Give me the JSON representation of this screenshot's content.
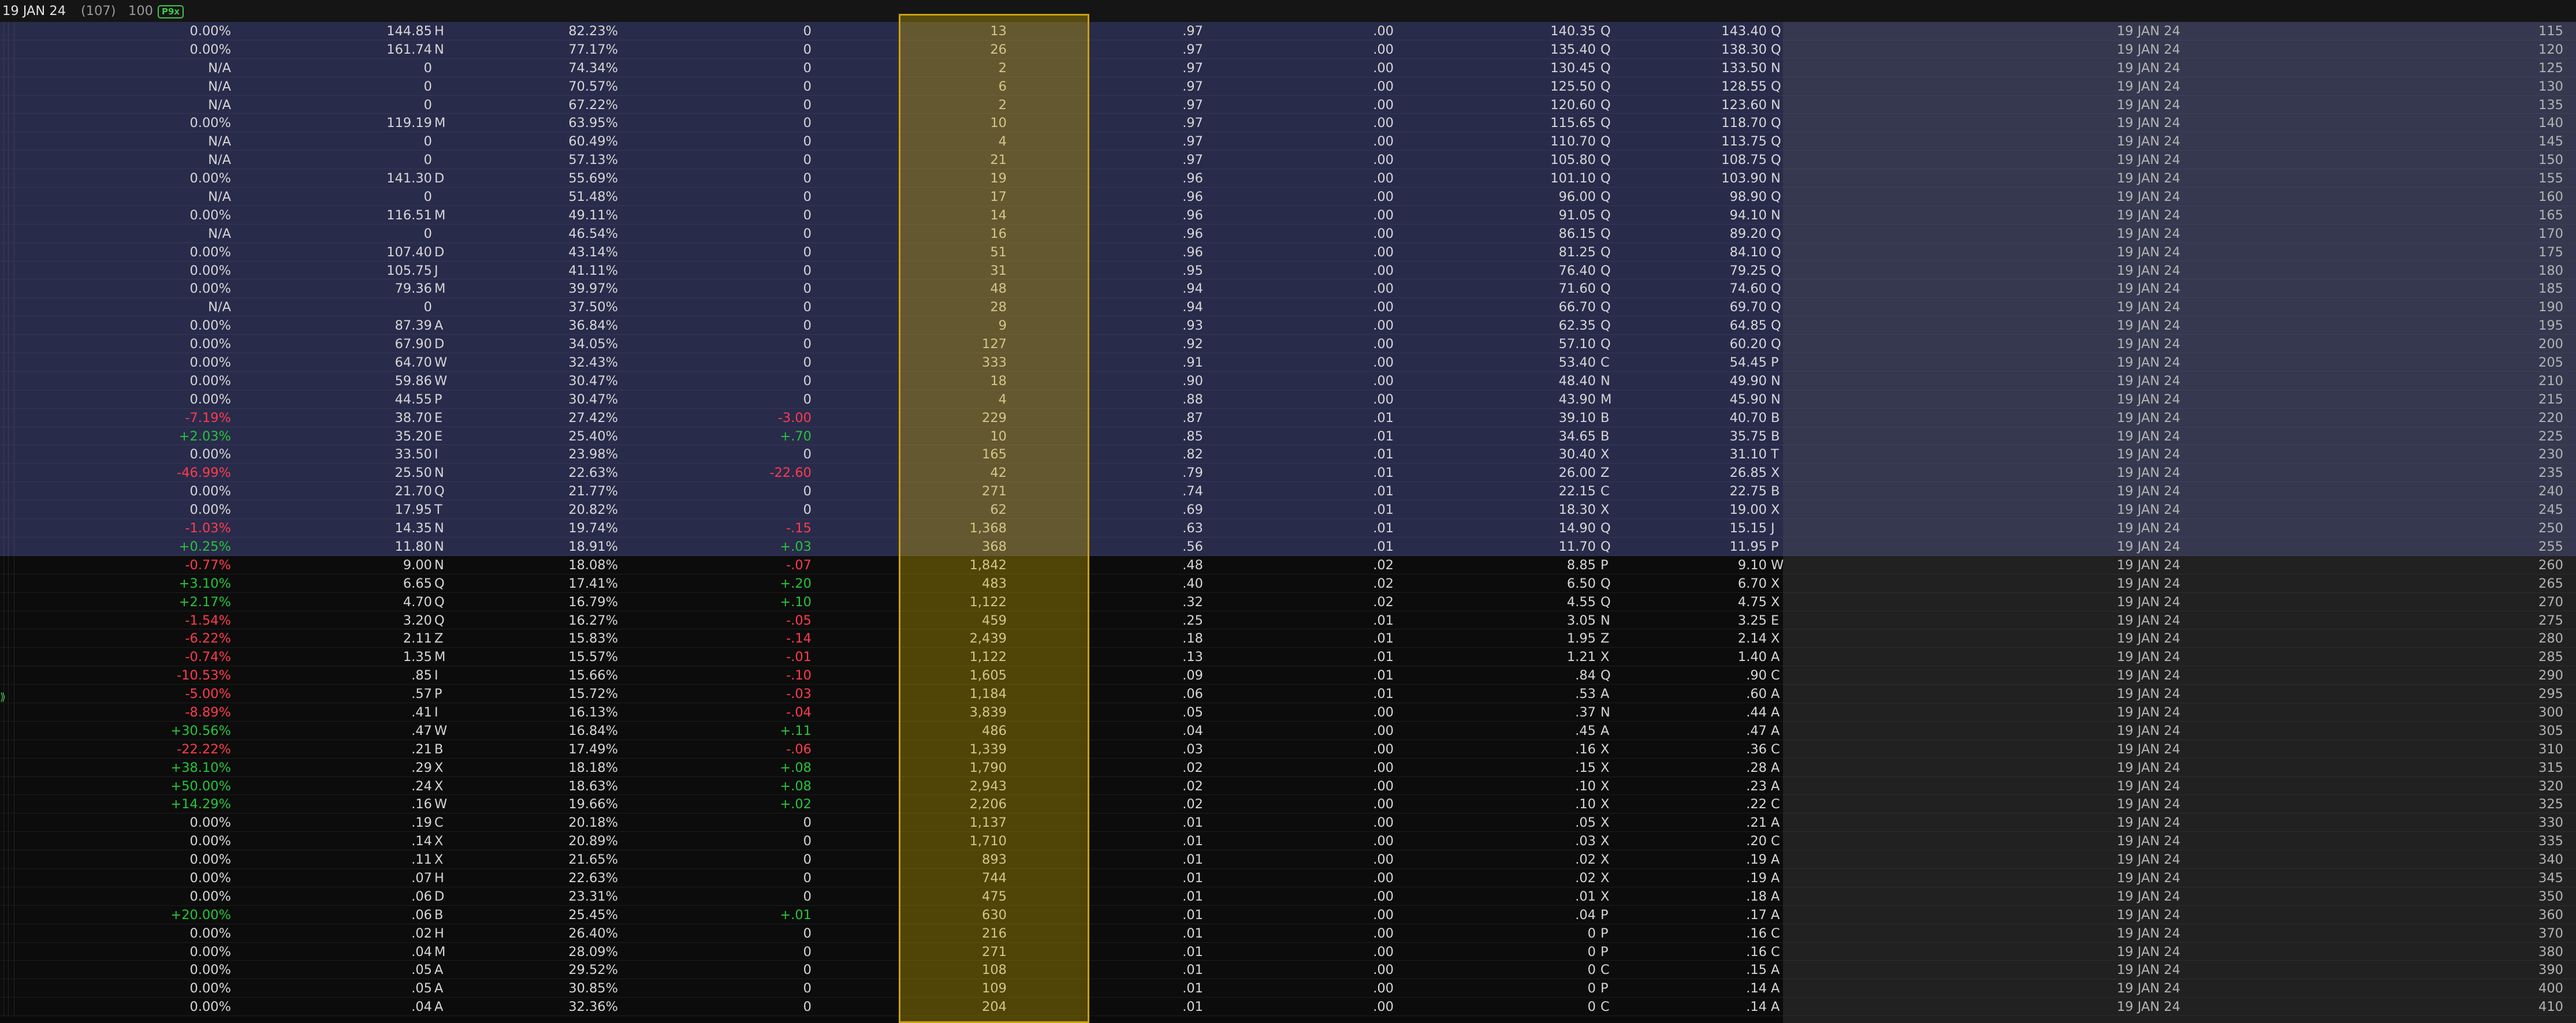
{
  "header": {
    "expiration_label": "19 JAN 24",
    "days_to_expiration": "(107)",
    "multiplier": "100",
    "badge": "P9x"
  },
  "colors": {
    "itm_background": "#292b4b",
    "otm_background": "#0c0c0c",
    "volume_highlight": "#ceaa00",
    "positive": "#26c53a",
    "negative": "#ff3b4d"
  },
  "rows": [
    {
      "chg": "0.00%",
      "last": "144.85",
      "last_x": "H",
      "iv": "82.23%",
      "net_chg": "0",
      "volume": "13",
      "delta": ".97",
      "gamma": ".00",
      "bid": "140.35",
      "bid_x": "Q",
      "ask": "143.40",
      "ask_x": "Q",
      "exp": "19 JAN 24",
      "strike": "115",
      "itm": true
    },
    {
      "chg": "0.00%",
      "last": "161.74",
      "last_x": "N",
      "iv": "77.17%",
      "net_chg": "0",
      "volume": "26",
      "delta": ".97",
      "gamma": ".00",
      "bid": "135.40",
      "bid_x": "Q",
      "ask": "138.30",
      "ask_x": "Q",
      "exp": "19 JAN 24",
      "strike": "120",
      "itm": true
    },
    {
      "chg": "N/A",
      "last": "0",
      "last_x": "",
      "iv": "74.34%",
      "net_chg": "0",
      "volume": "2",
      "delta": ".97",
      "gamma": ".00",
      "bid": "130.45",
      "bid_x": "Q",
      "ask": "133.50",
      "ask_x": "N",
      "exp": "19 JAN 24",
      "strike": "125",
      "itm": true
    },
    {
      "chg": "N/A",
      "last": "0",
      "last_x": "",
      "iv": "70.57%",
      "net_chg": "0",
      "volume": "6",
      "delta": ".97",
      "gamma": ".00",
      "bid": "125.50",
      "bid_x": "Q",
      "ask": "128.55",
      "ask_x": "Q",
      "exp": "19 JAN 24",
      "strike": "130",
      "itm": true
    },
    {
      "chg": "N/A",
      "last": "0",
      "last_x": "",
      "iv": "67.22%",
      "net_chg": "0",
      "volume": "2",
      "delta": ".97",
      "gamma": ".00",
      "bid": "120.60",
      "bid_x": "Q",
      "ask": "123.60",
      "ask_x": "N",
      "exp": "19 JAN 24",
      "strike": "135",
      "itm": true
    },
    {
      "chg": "0.00%",
      "last": "119.19",
      "last_x": "M",
      "iv": "63.95%",
      "net_chg": "0",
      "volume": "10",
      "delta": ".97",
      "gamma": ".00",
      "bid": "115.65",
      "bid_x": "Q",
      "ask": "118.70",
      "ask_x": "Q",
      "exp": "19 JAN 24",
      "strike": "140",
      "itm": true
    },
    {
      "chg": "N/A",
      "last": "0",
      "last_x": "",
      "iv": "60.49%",
      "net_chg": "0",
      "volume": "4",
      "delta": ".97",
      "gamma": ".00",
      "bid": "110.70",
      "bid_x": "Q",
      "ask": "113.75",
      "ask_x": "Q",
      "exp": "19 JAN 24",
      "strike": "145",
      "itm": true
    },
    {
      "chg": "N/A",
      "last": "0",
      "last_x": "",
      "iv": "57.13%",
      "net_chg": "0",
      "volume": "21",
      "delta": ".97",
      "gamma": ".00",
      "bid": "105.80",
      "bid_x": "Q",
      "ask": "108.75",
      "ask_x": "Q",
      "exp": "19 JAN 24",
      "strike": "150",
      "itm": true
    },
    {
      "chg": "0.00%",
      "last": "141.30",
      "last_x": "D",
      "iv": "55.69%",
      "net_chg": "0",
      "volume": "19",
      "delta": ".96",
      "gamma": ".00",
      "bid": "101.10",
      "bid_x": "Q",
      "ask": "103.90",
      "ask_x": "N",
      "exp": "19 JAN 24",
      "strike": "155",
      "itm": true
    },
    {
      "chg": "N/A",
      "last": "0",
      "last_x": "",
      "iv": "51.48%",
      "net_chg": "0",
      "volume": "17",
      "delta": ".96",
      "gamma": ".00",
      "bid": "96.00",
      "bid_x": "Q",
      "ask": "98.90",
      "ask_x": "Q",
      "exp": "19 JAN 24",
      "strike": "160",
      "itm": true
    },
    {
      "chg": "0.00%",
      "last": "116.51",
      "last_x": "M",
      "iv": "49.11%",
      "net_chg": "0",
      "volume": "14",
      "delta": ".96",
      "gamma": ".00",
      "bid": "91.05",
      "bid_x": "Q",
      "ask": "94.10",
      "ask_x": "N",
      "exp": "19 JAN 24",
      "strike": "165",
      "itm": true
    },
    {
      "chg": "N/A",
      "last": "0",
      "last_x": "",
      "iv": "46.54%",
      "net_chg": "0",
      "volume": "16",
      "delta": ".96",
      "gamma": ".00",
      "bid": "86.15",
      "bid_x": "Q",
      "ask": "89.20",
      "ask_x": "Q",
      "exp": "19 JAN 24",
      "strike": "170",
      "itm": true
    },
    {
      "chg": "0.00%",
      "last": "107.40",
      "last_x": "D",
      "iv": "43.14%",
      "net_chg": "0",
      "volume": "51",
      "delta": ".96",
      "gamma": ".00",
      "bid": "81.25",
      "bid_x": "Q",
      "ask": "84.10",
      "ask_x": "Q",
      "exp": "19 JAN 24",
      "strike": "175",
      "itm": true
    },
    {
      "chg": "0.00%",
      "last": "105.75",
      "last_x": "J",
      "iv": "41.11%",
      "net_chg": "0",
      "volume": "31",
      "delta": ".95",
      "gamma": ".00",
      "bid": "76.40",
      "bid_x": "Q",
      "ask": "79.25",
      "ask_x": "Q",
      "exp": "19 JAN 24",
      "strike": "180",
      "itm": true
    },
    {
      "chg": "0.00%",
      "last": "79.36",
      "last_x": "M",
      "iv": "39.97%",
      "net_chg": "0",
      "volume": "48",
      "delta": ".94",
      "gamma": ".00",
      "bid": "71.60",
      "bid_x": "Q",
      "ask": "74.60",
      "ask_x": "Q",
      "exp": "19 JAN 24",
      "strike": "185",
      "itm": true
    },
    {
      "chg": "N/A",
      "last": "0",
      "last_x": "",
      "iv": "37.50%",
      "net_chg": "0",
      "volume": "28",
      "delta": ".94",
      "gamma": ".00",
      "bid": "66.70",
      "bid_x": "Q",
      "ask": "69.70",
      "ask_x": "Q",
      "exp": "19 JAN 24",
      "strike": "190",
      "itm": true
    },
    {
      "chg": "0.00%",
      "last": "87.39",
      "last_x": "A",
      "iv": "36.84%",
      "net_chg": "0",
      "volume": "9",
      "delta": ".93",
      "gamma": ".00",
      "bid": "62.35",
      "bid_x": "Q",
      "ask": "64.85",
      "ask_x": "Q",
      "exp": "19 JAN 24",
      "strike": "195",
      "itm": true
    },
    {
      "chg": "0.00%",
      "last": "67.90",
      "last_x": "D",
      "iv": "34.05%",
      "net_chg": "0",
      "volume": "127",
      "delta": ".92",
      "gamma": ".00",
      "bid": "57.10",
      "bid_x": "Q",
      "ask": "60.20",
      "ask_x": "Q",
      "exp": "19 JAN 24",
      "strike": "200",
      "itm": true
    },
    {
      "chg": "0.00%",
      "last": "64.70",
      "last_x": "W",
      "iv": "32.43%",
      "net_chg": "0",
      "volume": "333",
      "delta": ".91",
      "gamma": ".00",
      "bid": "53.40",
      "bid_x": "C",
      "ask": "54.45",
      "ask_x": "P",
      "exp": "19 JAN 24",
      "strike": "205",
      "itm": true
    },
    {
      "chg": "0.00%",
      "last": "59.86",
      "last_x": "W",
      "iv": "30.47%",
      "net_chg": "0",
      "volume": "18",
      "delta": ".90",
      "gamma": ".00",
      "bid": "48.40",
      "bid_x": "N",
      "ask": "49.90",
      "ask_x": "N",
      "exp": "19 JAN 24",
      "strike": "210",
      "itm": true
    },
    {
      "chg": "0.00%",
      "last": "44.55",
      "last_x": "P",
      "iv": "30.47%",
      "net_chg": "0",
      "volume": "4",
      "delta": ".88",
      "gamma": ".00",
      "bid": "43.90",
      "bid_x": "M",
      "ask": "45.90",
      "ask_x": "N",
      "exp": "19 JAN 24",
      "strike": "215",
      "itm": true
    },
    {
      "chg": "-7.19%",
      "last": "38.70",
      "last_x": "E",
      "iv": "27.42%",
      "net_chg": "-3.00",
      "volume": "229",
      "delta": ".87",
      "gamma": ".01",
      "bid": "39.10",
      "bid_x": "B",
      "ask": "40.70",
      "ask_x": "B",
      "exp": "19 JAN 24",
      "strike": "220",
      "itm": true
    },
    {
      "chg": "+2.03%",
      "last": "35.20",
      "last_x": "E",
      "iv": "25.40%",
      "net_chg": "+.70",
      "volume": "10",
      "delta": ".85",
      "gamma": ".01",
      "bid": "34.65",
      "bid_x": "B",
      "ask": "35.75",
      "ask_x": "B",
      "exp": "19 JAN 24",
      "strike": "225",
      "itm": true
    },
    {
      "chg": "0.00%",
      "last": "33.50",
      "last_x": "I",
      "iv": "23.98%",
      "net_chg": "0",
      "volume": "165",
      "delta": ".82",
      "gamma": ".01",
      "bid": "30.40",
      "bid_x": "X",
      "ask": "31.10",
      "ask_x": "T",
      "exp": "19 JAN 24",
      "strike": "230",
      "itm": true
    },
    {
      "chg": "-46.99%",
      "last": "25.50",
      "last_x": "N",
      "iv": "22.63%",
      "net_chg": "-22.60",
      "volume": "42",
      "delta": ".79",
      "gamma": ".01",
      "bid": "26.00",
      "bid_x": "Z",
      "ask": "26.85",
      "ask_x": "X",
      "exp": "19 JAN 24",
      "strike": "235",
      "itm": true
    },
    {
      "chg": "0.00%",
      "last": "21.70",
      "last_x": "Q",
      "iv": "21.77%",
      "net_chg": "0",
      "volume": "271",
      "delta": ".74",
      "gamma": ".01",
      "bid": "22.15",
      "bid_x": "C",
      "ask": "22.75",
      "ask_x": "B",
      "exp": "19 JAN 24",
      "strike": "240",
      "itm": true
    },
    {
      "chg": "0.00%",
      "last": "17.95",
      "last_x": "T",
      "iv": "20.82%",
      "net_chg": "0",
      "volume": "62",
      "delta": ".69",
      "gamma": ".01",
      "bid": "18.30",
      "bid_x": "X",
      "ask": "19.00",
      "ask_x": "X",
      "exp": "19 JAN 24",
      "strike": "245",
      "itm": true
    },
    {
      "chg": "-1.03%",
      "last": "14.35",
      "last_x": "N",
      "iv": "19.74%",
      "net_chg": "-.15",
      "volume": "1,368",
      "delta": ".63",
      "gamma": ".01",
      "bid": "14.90",
      "bid_x": "Q",
      "ask": "15.15",
      "ask_x": "J",
      "exp": "19 JAN 24",
      "strike": "250",
      "itm": true
    },
    {
      "chg": "+0.25%",
      "last": "11.80",
      "last_x": "N",
      "iv": "18.91%",
      "net_chg": "+.03",
      "volume": "368",
      "delta": ".56",
      "gamma": ".01",
      "bid": "11.70",
      "bid_x": "Q",
      "ask": "11.95",
      "ask_x": "P",
      "exp": "19 JAN 24",
      "strike": "255",
      "itm": true
    },
    {
      "chg": "-0.77%",
      "last": "9.00",
      "last_x": "N",
      "iv": "18.08%",
      "net_chg": "-.07",
      "volume": "1,842",
      "delta": ".48",
      "gamma": ".02",
      "bid": "8.85",
      "bid_x": "P",
      "ask": "9.10",
      "ask_x": "W",
      "exp": "19 JAN 24",
      "strike": "260",
      "itm": false
    },
    {
      "chg": "+3.10%",
      "last": "6.65",
      "last_x": "Q",
      "iv": "17.41%",
      "net_chg": "+.20",
      "volume": "483",
      "delta": ".40",
      "gamma": ".02",
      "bid": "6.50",
      "bid_x": "Q",
      "ask": "6.70",
      "ask_x": "X",
      "exp": "19 JAN 24",
      "strike": "265",
      "itm": false
    },
    {
      "chg": "+2.17%",
      "last": "4.70",
      "last_x": "Q",
      "iv": "16.79%",
      "net_chg": "+.10",
      "volume": "1,122",
      "delta": ".32",
      "gamma": ".02",
      "bid": "4.55",
      "bid_x": "Q",
      "ask": "4.75",
      "ask_x": "X",
      "exp": "19 JAN 24",
      "strike": "270",
      "itm": false
    },
    {
      "chg": "-1.54%",
      "last": "3.20",
      "last_x": "Q",
      "iv": "16.27%",
      "net_chg": "-.05",
      "volume": "459",
      "delta": ".25",
      "gamma": ".01",
      "bid": "3.05",
      "bid_x": "N",
      "ask": "3.25",
      "ask_x": "E",
      "exp": "19 JAN 24",
      "strike": "275",
      "itm": false
    },
    {
      "chg": "-6.22%",
      "last": "2.11",
      "last_x": "Z",
      "iv": "15.83%",
      "net_chg": "-.14",
      "volume": "2,439",
      "delta": ".18",
      "gamma": ".01",
      "bid": "1.95",
      "bid_x": "Z",
      "ask": "2.14",
      "ask_x": "X",
      "exp": "19 JAN 24",
      "strike": "280",
      "itm": false
    },
    {
      "chg": "-0.74%",
      "last": "1.35",
      "last_x": "M",
      "iv": "15.57%",
      "net_chg": "-.01",
      "volume": "1,122",
      "delta": ".13",
      "gamma": ".01",
      "bid": "1.21",
      "bid_x": "X",
      "ask": "1.40",
      "ask_x": "A",
      "exp": "19 JAN 24",
      "strike": "285",
      "itm": false
    },
    {
      "chg": "-10.53%",
      "last": ".85",
      "last_x": "I",
      "iv": "15.66%",
      "net_chg": "-.10",
      "volume": "1,605",
      "delta": ".09",
      "gamma": ".01",
      "bid": ".84",
      "bid_x": "Q",
      "ask": ".90",
      "ask_x": "C",
      "exp": "19 JAN 24",
      "strike": "290",
      "itm": false
    },
    {
      "chg": "-5.00%",
      "last": ".57",
      "last_x": "P",
      "iv": "15.72%",
      "net_chg": "-.03",
      "volume": "1,184",
      "delta": ".06",
      "gamma": ".01",
      "bid": ".53",
      "bid_x": "A",
      "ask": ".60",
      "ask_x": "A",
      "exp": "19 JAN 24",
      "strike": "295",
      "itm": false
    },
    {
      "chg": "-8.89%",
      "last": ".41",
      "last_x": "I",
      "iv": "16.13%",
      "net_chg": "-.04",
      "volume": "3,839",
      "delta": ".05",
      "gamma": ".00",
      "bid": ".37",
      "bid_x": "N",
      "ask": ".44",
      "ask_x": "A",
      "exp": "19 JAN 24",
      "strike": "300",
      "itm": false
    },
    {
      "chg": "+30.56%",
      "last": ".47",
      "last_x": "W",
      "iv": "16.84%",
      "net_chg": "+.11",
      "volume": "486",
      "delta": ".04",
      "gamma": ".00",
      "bid": ".45",
      "bid_x": "A",
      "ask": ".47",
      "ask_x": "A",
      "exp": "19 JAN 24",
      "strike": "305",
      "itm": false
    },
    {
      "chg": "-22.22%",
      "last": ".21",
      "last_x": "B",
      "iv": "17.49%",
      "net_chg": "-.06",
      "volume": "1,339",
      "delta": ".03",
      "gamma": ".00",
      "bid": ".16",
      "bid_x": "X",
      "ask": ".36",
      "ask_x": "C",
      "exp": "19 JAN 24",
      "strike": "310",
      "itm": false
    },
    {
      "chg": "+38.10%",
      "last": ".29",
      "last_x": "X",
      "iv": "18.18%",
      "net_chg": "+.08",
      "volume": "1,790",
      "delta": ".02",
      "gamma": ".00",
      "bid": ".15",
      "bid_x": "X",
      "ask": ".28",
      "ask_x": "A",
      "exp": "19 JAN 24",
      "strike": "315",
      "itm": false
    },
    {
      "chg": "+50.00%",
      "last": ".24",
      "last_x": "X",
      "iv": "18.63%",
      "net_chg": "+.08",
      "volume": "2,943",
      "delta": ".02",
      "gamma": ".00",
      "bid": ".10",
      "bid_x": "X",
      "ask": ".23",
      "ask_x": "A",
      "exp": "19 JAN 24",
      "strike": "320",
      "itm": false
    },
    {
      "chg": "+14.29%",
      "last": ".16",
      "last_x": "W",
      "iv": "19.66%",
      "net_chg": "+.02",
      "volume": "2,206",
      "delta": ".02",
      "gamma": ".00",
      "bid": ".10",
      "bid_x": "X",
      "ask": ".22",
      "ask_x": "C",
      "exp": "19 JAN 24",
      "strike": "325",
      "itm": false
    },
    {
      "chg": "0.00%",
      "last": ".19",
      "last_x": "C",
      "iv": "20.18%",
      "net_chg": "0",
      "volume": "1,137",
      "delta": ".01",
      "gamma": ".00",
      "bid": ".05",
      "bid_x": "X",
      "ask": ".21",
      "ask_x": "A",
      "exp": "19 JAN 24",
      "strike": "330",
      "itm": false
    },
    {
      "chg": "0.00%",
      "last": ".14",
      "last_x": "X",
      "iv": "20.89%",
      "net_chg": "0",
      "volume": "1,710",
      "delta": ".01",
      "gamma": ".00",
      "bid": ".03",
      "bid_x": "X",
      "ask": ".20",
      "ask_x": "C",
      "exp": "19 JAN 24",
      "strike": "335",
      "itm": false
    },
    {
      "chg": "0.00%",
      "last": ".11",
      "last_x": "X",
      "iv": "21.65%",
      "net_chg": "0",
      "volume": "893",
      "delta": ".01",
      "gamma": ".00",
      "bid": ".02",
      "bid_x": "X",
      "ask": ".19",
      "ask_x": "A",
      "exp": "19 JAN 24",
      "strike": "340",
      "itm": false
    },
    {
      "chg": "0.00%",
      "last": ".07",
      "last_x": "H",
      "iv": "22.63%",
      "net_chg": "0",
      "volume": "744",
      "delta": ".01",
      "gamma": ".00",
      "bid": ".02",
      "bid_x": "X",
      "ask": ".19",
      "ask_x": "A",
      "exp": "19 JAN 24",
      "strike": "345",
      "itm": false
    },
    {
      "chg": "0.00%",
      "last": ".06",
      "last_x": "D",
      "iv": "23.31%",
      "net_chg": "0",
      "volume": "475",
      "delta": ".01",
      "gamma": ".00",
      "bid": ".01",
      "bid_x": "X",
      "ask": ".18",
      "ask_x": "A",
      "exp": "19 JAN 24",
      "strike": "350",
      "itm": false
    },
    {
      "chg": "+20.00%",
      "last": ".06",
      "last_x": "B",
      "iv": "25.45%",
      "net_chg": "+.01",
      "volume": "630",
      "delta": ".01",
      "gamma": ".00",
      "bid": ".04",
      "bid_x": "P",
      "ask": ".17",
      "ask_x": "A",
      "exp": "19 JAN 24",
      "strike": "360",
      "itm": false
    },
    {
      "chg": "0.00%",
      "last": ".02",
      "last_x": "H",
      "iv": "26.40%",
      "net_chg": "0",
      "volume": "216",
      "delta": ".01",
      "gamma": ".00",
      "bid": "0",
      "bid_x": "P",
      "ask": ".16",
      "ask_x": "C",
      "exp": "19 JAN 24",
      "strike": "370",
      "itm": false
    },
    {
      "chg": "0.00%",
      "last": ".04",
      "last_x": "M",
      "iv": "28.09%",
      "net_chg": "0",
      "volume": "271",
      "delta": ".01",
      "gamma": ".00",
      "bid": "0",
      "bid_x": "P",
      "ask": ".16",
      "ask_x": "C",
      "exp": "19 JAN 24",
      "strike": "380",
      "itm": false
    },
    {
      "chg": "0.00%",
      "last": ".05",
      "last_x": "A",
      "iv": "29.52%",
      "net_chg": "0",
      "volume": "108",
      "delta": ".01",
      "gamma": ".00",
      "bid": "0",
      "bid_x": "C",
      "ask": ".15",
      "ask_x": "A",
      "exp": "19 JAN 24",
      "strike": "390",
      "itm": false
    },
    {
      "chg": "0.00%",
      "last": ".05",
      "last_x": "A",
      "iv": "30.85%",
      "net_chg": "0",
      "volume": "109",
      "delta": ".01",
      "gamma": ".00",
      "bid": "0",
      "bid_x": "P",
      "ask": ".14",
      "ask_x": "A",
      "exp": "19 JAN 24",
      "strike": "400",
      "itm": false
    },
    {
      "chg": "0.00%",
      "last": ".04",
      "last_x": "A",
      "iv": "32.36%",
      "net_chg": "0",
      "volume": "204",
      "delta": ".01",
      "gamma": ".00",
      "bid": "0",
      "bid_x": "C",
      "ask": ".14",
      "ask_x": "A",
      "exp": "19 JAN 24",
      "strike": "410",
      "itm": false
    }
  ]
}
